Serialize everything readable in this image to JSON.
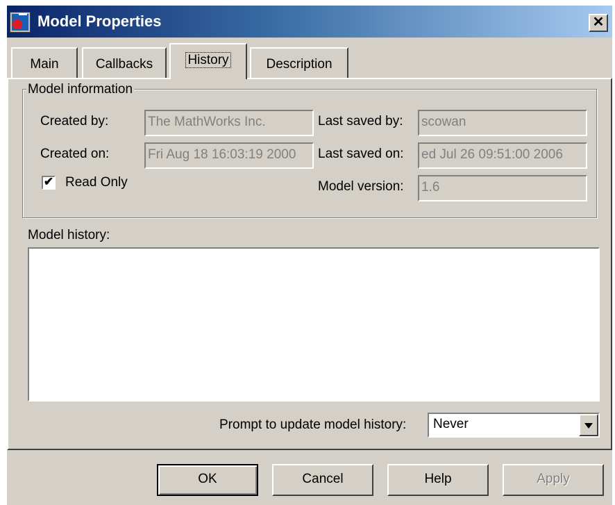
{
  "window": {
    "title": "Model Properties",
    "close_label": "✕"
  },
  "tabs": [
    {
      "label": "Main"
    },
    {
      "label": "Callbacks"
    },
    {
      "label": "History"
    },
    {
      "label": "Description"
    }
  ],
  "active_tab": "History",
  "model_info": {
    "group_label": "Model information",
    "created_by_label": "Created by:",
    "created_by_value": "The MathWorks Inc.",
    "created_on_label": "Created on:",
    "created_on_value": "Fri Aug 18 16:03:19 2000",
    "last_saved_by_label": "Last saved by:",
    "last_saved_by_value": "scowan",
    "last_saved_on_label": "Last saved on:",
    "last_saved_on_value": "ed Jul 26 09:51:00 2006",
    "model_version_label": "Model version:",
    "model_version_value": "1.6",
    "read_only_label": "Read Only",
    "read_only_checked": true,
    "check_mark": "✔"
  },
  "history": {
    "label": "Model history:",
    "text": ""
  },
  "prompt": {
    "label": "Prompt to update model history:",
    "selected": "Never"
  },
  "buttons": {
    "ok": "OK",
    "cancel": "Cancel",
    "help": "Help",
    "apply": "Apply"
  },
  "colors": {
    "dialog_bg": "#d4d0c8",
    "titlebar_start": "#0a246a",
    "titlebar_end": "#a6caf0",
    "disabled_text": "#808080"
  },
  "icons": {
    "app": "simulink-model-icon",
    "close": "close-icon",
    "dropdown": "chevron-down-icon",
    "checkbox": "check-icon"
  }
}
